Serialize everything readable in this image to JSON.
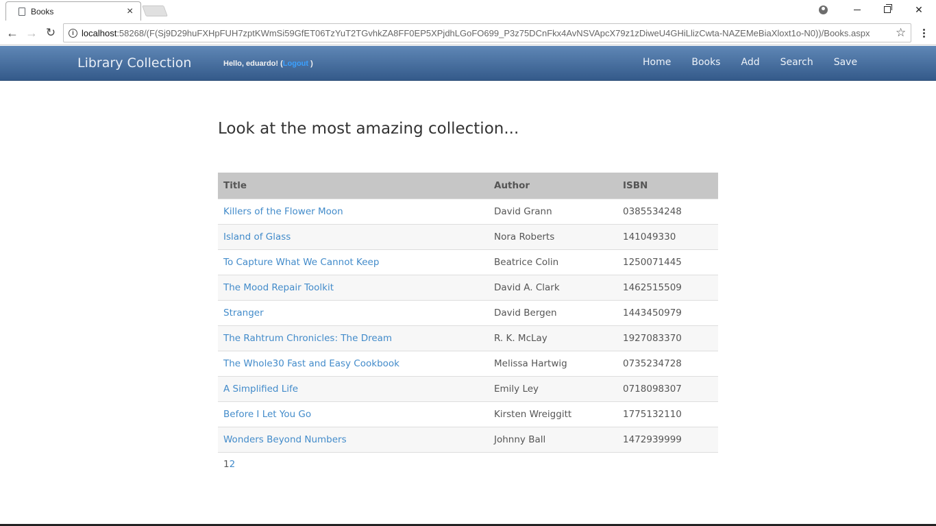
{
  "browser": {
    "tab_title": "Books",
    "tab_close": "×",
    "url_host": "localhost",
    "url_rest": ":58268/(F(Sj9D29huFXHpFUH7zptKWmSi59GfET06TzYuT2TGvhkZA8FF0EP5XPjdhLGoFO699_P3z75DCnFkx4AvNSVApcX79z1zDiweU4GHiLlizCwta-NAZEMeBiaXloxt1o-N0))/Books.aspx",
    "back": "←",
    "forward": "→",
    "reload": "↻",
    "star": "☆",
    "info": "i"
  },
  "navbar": {
    "brand": "Library Collection",
    "hello_prefix": "Hello, eduardo! (",
    "logout": "Logout",
    "hello_suffix": " )",
    "links": [
      "Home",
      "Books",
      "Add",
      "Search",
      "Save"
    ],
    "colors": {
      "top": "#5f87b6",
      "bottom": "#345a8a"
    }
  },
  "main": {
    "heading": "Look at the most amazing collection...",
    "table": {
      "headers": [
        "Title",
        "Author",
        "ISBN"
      ],
      "rows": [
        [
          "Killers of the Flower Moon",
          "David Grann",
          "0385534248"
        ],
        [
          "Island of Glass",
          "Nora Roberts",
          "141049330"
        ],
        [
          "To Capture What We Cannot Keep",
          "Beatrice Colin",
          "1250071445"
        ],
        [
          "The Mood Repair Toolkit",
          "David A. Clark",
          "1462515509"
        ],
        [
          "Stranger",
          "David Bergen",
          "1443450979"
        ],
        [
          "The Rahtrum Chronicles: The Dream",
          "R. K. McLay",
          "1927083370"
        ],
        [
          "The Whole30 Fast and Easy Cookbook",
          "Melissa Hartwig",
          "0735234728"
        ],
        [
          "A Simplified Life",
          "Emily Ley",
          "0718098307"
        ],
        [
          "Before I Let You Go",
          "Kirsten Wreiggitt",
          "1775132110"
        ],
        [
          "Wonders Beyond Numbers",
          "Johnny Ball",
          "1472939999"
        ]
      ]
    },
    "pager": {
      "current": "1",
      "next": "2"
    }
  }
}
